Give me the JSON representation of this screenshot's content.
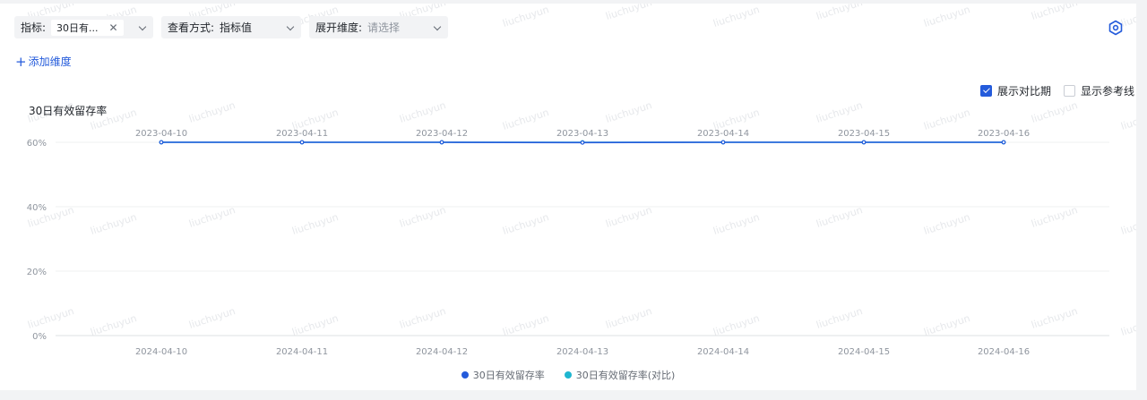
{
  "filters": {
    "metric": {
      "label": "指标:",
      "chip": "30日有...",
      "clear": "✕"
    },
    "view": {
      "label": "查看方式:",
      "value": "指标值"
    },
    "expand": {
      "label": "展开维度:",
      "placeholder": "请选择"
    }
  },
  "add_dimension": {
    "plus": "+",
    "label": "添加维度"
  },
  "options": {
    "show_compare": {
      "label": "展示对比期",
      "checked": true
    },
    "show_reference": {
      "label": "显示参考线",
      "checked": false
    }
  },
  "watermark_text": "liuchuyun",
  "colors": {
    "primary": "#245bdb",
    "compare": "#1fb6d0",
    "accent": "#245bdb"
  },
  "icons": {
    "settings": "gear-hexagon-icon",
    "dropdown": "chevron-down-icon",
    "clear": "close-icon",
    "add": "plus-icon"
  },
  "chart_data": {
    "type": "line",
    "title": "30日有效留存率",
    "y_ticks": [
      "60%",
      "40%",
      "20%",
      "0%"
    ],
    "ylim": [
      0,
      60
    ],
    "grid": true,
    "legend_position": "bottom-center",
    "x": [
      "2024-04-10",
      "2024-04-11",
      "2024-04-12",
      "2024-04-13",
      "2024-04-14",
      "2024-04-15",
      "2024-04-16"
    ],
    "x_compare": [
      "2023-04-10",
      "2023-04-11",
      "2023-04-12",
      "2023-04-13",
      "2023-04-14",
      "2023-04-15",
      "2023-04-16"
    ],
    "series": [
      {
        "name": "30日有效留存率",
        "values": [
          60,
          60,
          60,
          59.9,
          60,
          60,
          60
        ],
        "color": "#245bdb"
      },
      {
        "name": "30日有效留存率(对比)",
        "values": [
          60,
          60,
          60,
          60,
          60,
          60,
          60
        ],
        "color": "#1fb6d0"
      }
    ]
  }
}
